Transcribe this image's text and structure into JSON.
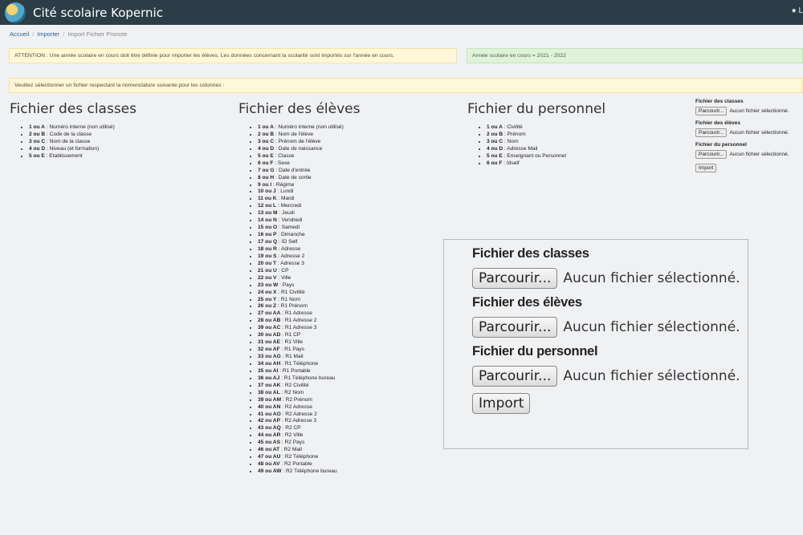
{
  "header": {
    "title": "Cité scolaire Kopernic",
    "right_text": "L"
  },
  "breadcrumb": [
    "Accueil",
    "Importer",
    "Import Fichier Pronote"
  ],
  "alerts": {
    "warning": "ATTENTION : Une année scolaire en cours doit être définie pour importer les élèves. Les données concernant la scolarité sont importés sur l'année en cours.",
    "year": "Année scolaire en cours = 2021 - 2022",
    "info": "Veuillez sélectionner un fichier respectant la nomenclature suivante pour les colonnes :"
  },
  "columns": [
    {
      "title": "Fichier des classes",
      "items": [
        [
          "1 ou A",
          "Numéro interne (non utilisé)"
        ],
        [
          "2 ou B",
          "Code de la classe"
        ],
        [
          "3 ou C",
          "Nom de la classe"
        ],
        [
          "4 ou D",
          "Niveau (et formation)"
        ],
        [
          "5 ou E",
          "Etablissement"
        ]
      ]
    },
    {
      "title": "Fichier des élèves",
      "items": [
        [
          "1 ou A",
          "Numéro interne (non utilisé)"
        ],
        [
          "2 ou B",
          "Nom de l'élève"
        ],
        [
          "3 ou C",
          "Prénom de l'élève"
        ],
        [
          "4 ou D",
          "Date de naissance"
        ],
        [
          "5 ou E",
          "Classe"
        ],
        [
          "6 ou F",
          "Sexe"
        ],
        [
          "7 ou G",
          "Date d'entrée"
        ],
        [
          "8 ou H",
          "Date de sortie"
        ],
        [
          "9 ou I",
          "Régime"
        ],
        [
          "10 ou J",
          "Lundi"
        ],
        [
          "11 ou K",
          "Mardi"
        ],
        [
          "12 ou L",
          "Mercredi"
        ],
        [
          "13 ou M",
          "Jeudi"
        ],
        [
          "14 ou N",
          "Vendredi"
        ],
        [
          "15 ou O",
          "Samedi"
        ],
        [
          "16 ou P",
          "Dimanche"
        ],
        [
          "17 ou Q",
          "ID Self"
        ],
        [
          "18 ou R",
          "Adresse"
        ],
        [
          "19 ou S",
          "Adresse 2"
        ],
        [
          "20 ou T",
          "Adresse 3"
        ],
        [
          "21 ou U",
          "CP"
        ],
        [
          "22 ou V",
          "Ville"
        ],
        [
          "23 ou W",
          "Pays"
        ],
        [
          "24 ou X",
          "R1 Civilité"
        ],
        [
          "25 ou Y",
          "R1 Nom"
        ],
        [
          "26 ou Z",
          "R1 Prénom"
        ],
        [
          "27 ou AA",
          "R1 Adresse"
        ],
        [
          "28 ou AB",
          "R1 Adresse 2"
        ],
        [
          "39 ou AC",
          "R1 Adresse 3"
        ],
        [
          "30 ou AD",
          "R1 CP"
        ],
        [
          "31 ou AE",
          "R1 Ville"
        ],
        [
          "32 ou AF",
          "R1 Pays"
        ],
        [
          "33 ou AG",
          "R1 Mail"
        ],
        [
          "34 ou AH",
          "R1 Téléphone"
        ],
        [
          "35 ou AI",
          "R1 Portable"
        ],
        [
          "36 ou AJ",
          "R1 Téléphone bureau"
        ],
        [
          "37 ou AK",
          "R2 Civilité"
        ],
        [
          "38 ou AL",
          "R2 Nom"
        ],
        [
          "39 ou AM",
          "R2 Prénom"
        ],
        [
          "40 ou AN",
          "R2 Adresse"
        ],
        [
          "41 ou AO",
          "R2 Adresse 2"
        ],
        [
          "42 ou AP",
          "R2 Adresse 3"
        ],
        [
          "43 ou AQ",
          "R2 CP"
        ],
        [
          "44 ou AR",
          "R2 Ville"
        ],
        [
          "45 ou AS",
          "R2 Pays"
        ],
        [
          "46 ou AT",
          "R2 Mail"
        ],
        [
          "47 ou AU",
          "R2 Téléphone"
        ],
        [
          "48 ou AV",
          "R2 Portable"
        ],
        [
          "49 ou AW",
          "R2 Téléphone bureau"
        ]
      ]
    },
    {
      "title": "Fichier du personnel",
      "items": [
        [
          "1 ou A",
          "Civilité"
        ],
        [
          "2 ou B",
          "Prénom"
        ],
        [
          "3 ou C",
          "Nom"
        ],
        [
          "4 ou D",
          "Adresse Mail"
        ],
        [
          "5 ou E",
          "Enseignant ou Personnel"
        ],
        [
          "6 ou F",
          "Idself"
        ]
      ]
    }
  ],
  "form": {
    "labels": [
      "Fichier des classes",
      "Fichier des élèves",
      "Fichier du personnel"
    ],
    "browse_label": "Parcourir...",
    "no_file": "Aucun fichier sélectionné.",
    "import_label": "Import"
  }
}
